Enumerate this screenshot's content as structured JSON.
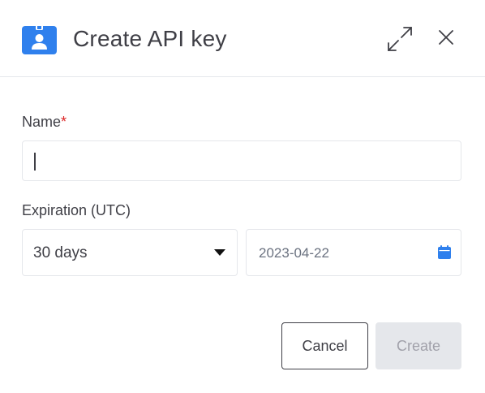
{
  "dialog": {
    "title": "Create API key",
    "icon": "id-badge-icon",
    "expand_icon": "expand-icon",
    "close_icon": "close-icon"
  },
  "form": {
    "name": {
      "label": "Name",
      "required_marker": "*",
      "value": ""
    },
    "expiration": {
      "label": "Expiration (UTC)",
      "selected_option": "30 days",
      "date_value": "2023-04-22",
      "date_icon": "calendar-icon"
    }
  },
  "actions": {
    "cancel_label": "Cancel",
    "create_label": "Create",
    "create_disabled": true
  },
  "colors": {
    "accent": "#2f80ed",
    "required": "#dc2626",
    "text": "#3f3f46",
    "border": "#e5e7eb",
    "disabled_bg": "#e5e7eb",
    "disabled_text": "#a1a1aa"
  }
}
